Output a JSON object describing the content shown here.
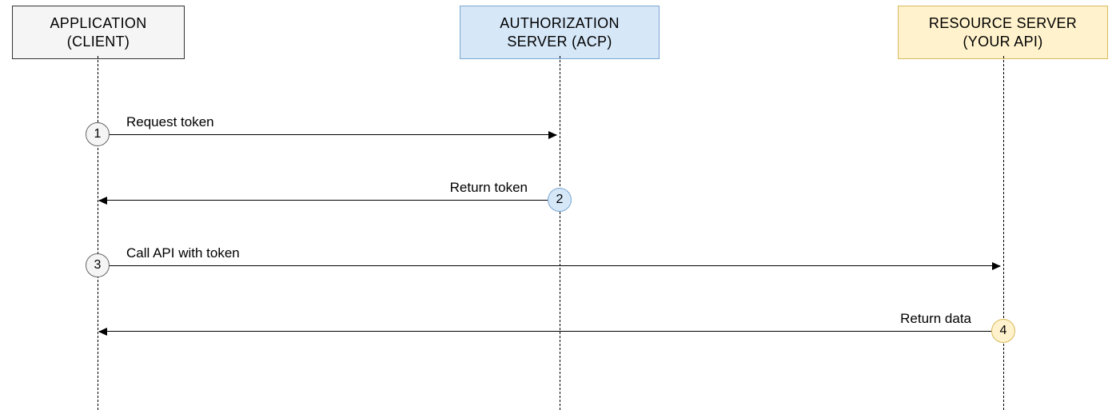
{
  "participants": {
    "client": {
      "line1": "APPLICATION",
      "line2": "(CLIENT)"
    },
    "auth": {
      "line1": "AUTHORIZATION",
      "line2": "SERVER (ACP)"
    },
    "resource": {
      "line1": "RESOURCE SERVER",
      "line2": "(YOUR API)"
    }
  },
  "steps": {
    "s1": {
      "num": "1",
      "label": "Request token"
    },
    "s2": {
      "num": "2",
      "label": "Return token"
    },
    "s3": {
      "num": "3",
      "label": "Call API with token"
    },
    "s4": {
      "num": "4",
      "label": "Return data"
    }
  },
  "chart_data": {
    "type": "sequence",
    "participants": [
      {
        "id": "client",
        "name": "APPLICATION (CLIENT)"
      },
      {
        "id": "auth",
        "name": "AUTHORIZATION SERVER (ACP)"
      },
      {
        "id": "resource",
        "name": "RESOURCE SERVER (YOUR API)"
      }
    ],
    "messages": [
      {
        "step": 1,
        "from": "client",
        "to": "auth",
        "label": "Request token"
      },
      {
        "step": 2,
        "from": "auth",
        "to": "client",
        "label": "Return token"
      },
      {
        "step": 3,
        "from": "client",
        "to": "resource",
        "label": "Call API with token"
      },
      {
        "step": 4,
        "from": "resource",
        "to": "client",
        "label": "Return data"
      }
    ]
  }
}
